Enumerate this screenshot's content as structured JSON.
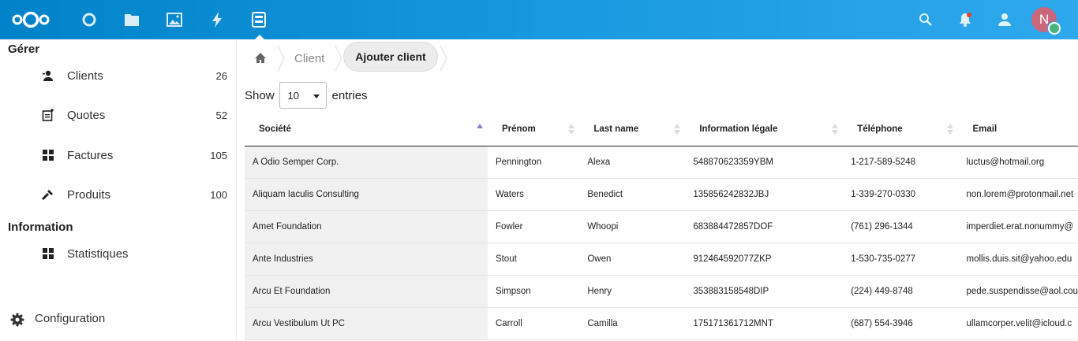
{
  "user": {
    "avatar_initial": "N"
  },
  "sidebar": {
    "caption_manage": "Gérer",
    "items": [
      {
        "label": "Clients",
        "count": "26",
        "icon": "contacts-icon"
      },
      {
        "label": "Quotes",
        "count": "52",
        "icon": "quote-icon"
      },
      {
        "label": "Factures",
        "count": "105",
        "icon": "grid-icon"
      },
      {
        "label": "Produits",
        "count": "100",
        "icon": "wrench-icon"
      }
    ],
    "caption_info": "Information",
    "stats_label": "Statistiques",
    "config_label": "Configuration"
  },
  "breadcrumb": {
    "client": "Client",
    "add_client": "Ajouter client"
  },
  "table_controls": {
    "show": "Show",
    "entries_value": "10",
    "entries": "entries"
  },
  "table": {
    "headers": [
      "Société",
      "Prénom",
      "Last name",
      "Information légale",
      "Téléphone",
      "Email"
    ],
    "rows": [
      [
        "A Odio Semper Corp.",
        "Pennington",
        "Alexa",
        "548870623359YBM",
        "1-217-589-5248",
        "luctus@hotmail.org"
      ],
      [
        "Aliquam Iaculis Consulting",
        "Waters",
        "Benedict",
        "135856242832JBJ",
        "1-339-270-0330",
        "non.lorem@protonmail.net"
      ],
      [
        "Amet Foundation",
        "Fowler",
        "Whoopi",
        "683884472857DOF",
        "(761) 296-1344",
        "imperdiet.erat.nonummy@"
      ],
      [
        "Ante Industries",
        "Stout",
        "Owen",
        "912464592077ZKP",
        "1-530-735-0277",
        "mollis.duis.sit@yahoo.edu"
      ],
      [
        "Arcu Et Foundation",
        "Simpson",
        "Henry",
        "353883158548DIP",
        "(224) 449-8748",
        "pede.suspendisse@aol.cou"
      ],
      [
        "Arcu Vestibulum Ut PC",
        "Carroll",
        "Camilla",
        "175171361712MNT",
        "(687) 554-3946",
        "ullamcorper.velit@icloud.c"
      ]
    ]
  },
  "colors": {
    "header": "#0082c9",
    "accent_sort": "#7b86d4",
    "avatar": "#c9687c",
    "status": "#49b382"
  }
}
